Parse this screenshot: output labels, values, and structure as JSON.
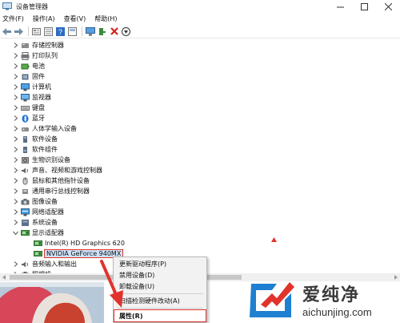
{
  "window": {
    "title": "设备管理器",
    "controls": [
      "minimize-icon",
      "maximize-icon",
      "close-icon"
    ]
  },
  "menu": [
    "文件(F)",
    "操作(A)",
    "查看(V)",
    "帮助(H)"
  ],
  "toolbar": [
    "back-icon",
    "forward-icon",
    "properties-icon",
    "update-icon",
    "help-icon",
    "details-icon",
    "monitor-icon",
    "add-hardware-icon",
    "remove-icon",
    "download-icon"
  ],
  "tree": [
    {
      "label": "存储控制器",
      "icon": "storage-icon",
      "expanded": false
    },
    {
      "label": "打印队列",
      "icon": "printer-icon",
      "expanded": false
    },
    {
      "label": "电池",
      "icon": "battery-icon",
      "expanded": false
    },
    {
      "label": "固件",
      "icon": "firmware-icon",
      "expanded": false
    },
    {
      "label": "计算机",
      "icon": "computer-icon",
      "expanded": false
    },
    {
      "label": "监视器",
      "icon": "monitor-icon",
      "expanded": false
    },
    {
      "label": "键盘",
      "icon": "keyboard-icon",
      "expanded": false
    },
    {
      "label": "蓝牙",
      "icon": "bluetooth-icon",
      "expanded": false
    },
    {
      "label": "人体学输入设备",
      "icon": "hid-icon",
      "expanded": false
    },
    {
      "label": "软件设备",
      "icon": "software-device-icon",
      "expanded": false
    },
    {
      "label": "软件组件",
      "icon": "software-component-icon",
      "expanded": false
    },
    {
      "label": "生物识别设备",
      "icon": "biometric-icon",
      "expanded": false
    },
    {
      "label": "声音、视频和游戏控制器",
      "icon": "sound-icon",
      "expanded": false
    },
    {
      "label": "鼠标和其他指针设备",
      "icon": "mouse-icon",
      "expanded": false
    },
    {
      "label": "通用串行总线控制器",
      "icon": "usb-icon",
      "expanded": false
    },
    {
      "label": "图像设备",
      "icon": "camera-icon",
      "expanded": false
    },
    {
      "label": "网络适配器",
      "icon": "network-icon",
      "expanded": false
    },
    {
      "label": "系统设备",
      "icon": "system-icon",
      "expanded": false
    },
    {
      "label": "显示适配器",
      "icon": "display-adapter-icon",
      "expanded": true
    },
    {
      "label": "Intel(R) HD Graphics 620",
      "icon": "display-adapter-icon",
      "child": true
    },
    {
      "label": "NVIDIA GeForce 940MX",
      "icon": "display-adapter-icon",
      "child": true,
      "selected": true
    },
    {
      "label": "音频输入和输出",
      "icon": "audio-icon",
      "expanded": false
    },
    {
      "label": "照相机",
      "icon": "camera-icon",
      "expanded": false
    }
  ],
  "context_menu": [
    {
      "label": "更新驱动程序(P)"
    },
    {
      "label": "禁用设备(D)"
    },
    {
      "label": "卸载设备(U)"
    },
    {
      "label": "扫描检测硬件改动(A)"
    },
    {
      "label": "属性(R)",
      "highlighted": true
    }
  ],
  "watermark": {
    "name": "爱纯净",
    "url": "aichunjing.com",
    "colors": {
      "blue": "#1f7fd0",
      "red": "#e0332c"
    }
  }
}
